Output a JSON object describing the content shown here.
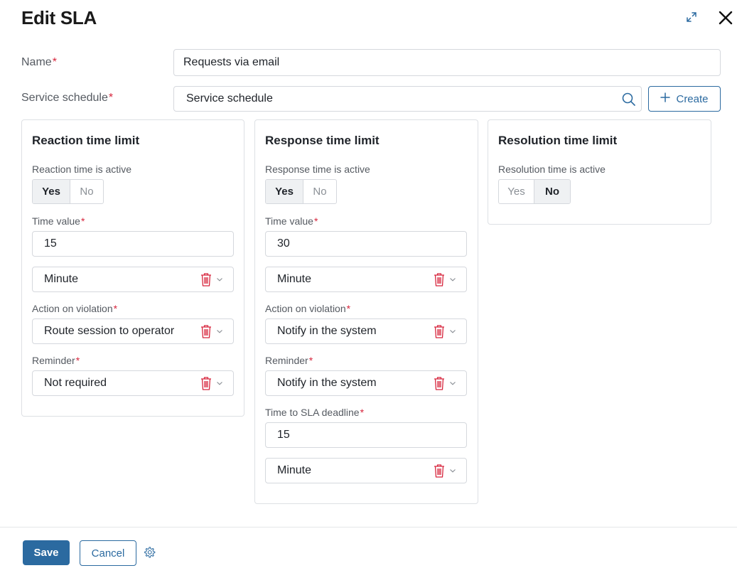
{
  "header": {
    "title": "Edit SLA"
  },
  "form": {
    "name": {
      "label": "Name",
      "required_mark": "*",
      "value": "Requests via email"
    },
    "schedule": {
      "label": "Service schedule",
      "required_mark": "*",
      "value": "Service schedule",
      "create_label": "Create"
    }
  },
  "reaction": {
    "title": "Reaction time limit",
    "active_label": "Reaction time is active",
    "yes": "Yes",
    "no": "No",
    "selected": "Yes",
    "time_label": "Time value",
    "time_value": "15",
    "unit": "Minute",
    "action_label": "Action on violation",
    "action_value": "Route session to operator",
    "reminder_label": "Reminder",
    "reminder_value": "Not required"
  },
  "response": {
    "title": "Response time limit",
    "active_label": "Response time is active",
    "yes": "Yes",
    "no": "No",
    "selected": "Yes",
    "time_label": "Time value",
    "time_value": "30",
    "unit": "Minute",
    "action_label": "Action on violation",
    "action_value": "Notify in the system",
    "reminder_label": "Reminder",
    "reminder_value": "Notify in the system",
    "deadline_label": "Time to SLA deadline",
    "deadline_value": "15",
    "deadline_unit": "Minute"
  },
  "resolution": {
    "title": "Resolution time limit",
    "active_label": "Resolution time is active",
    "yes": "Yes",
    "no": "No",
    "selected": "No"
  },
  "footer": {
    "save_label": "Save",
    "cancel_label": "Cancel"
  },
  "colors": {
    "accent": "#2b6aa0",
    "required": "#d7263d",
    "delete": "#d7263d",
    "border": "#d5d8dd"
  },
  "icons": [
    "expand-icon",
    "close-icon",
    "search-icon",
    "plus-icon",
    "trash-icon",
    "chevron-down-icon",
    "gear-icon"
  ]
}
